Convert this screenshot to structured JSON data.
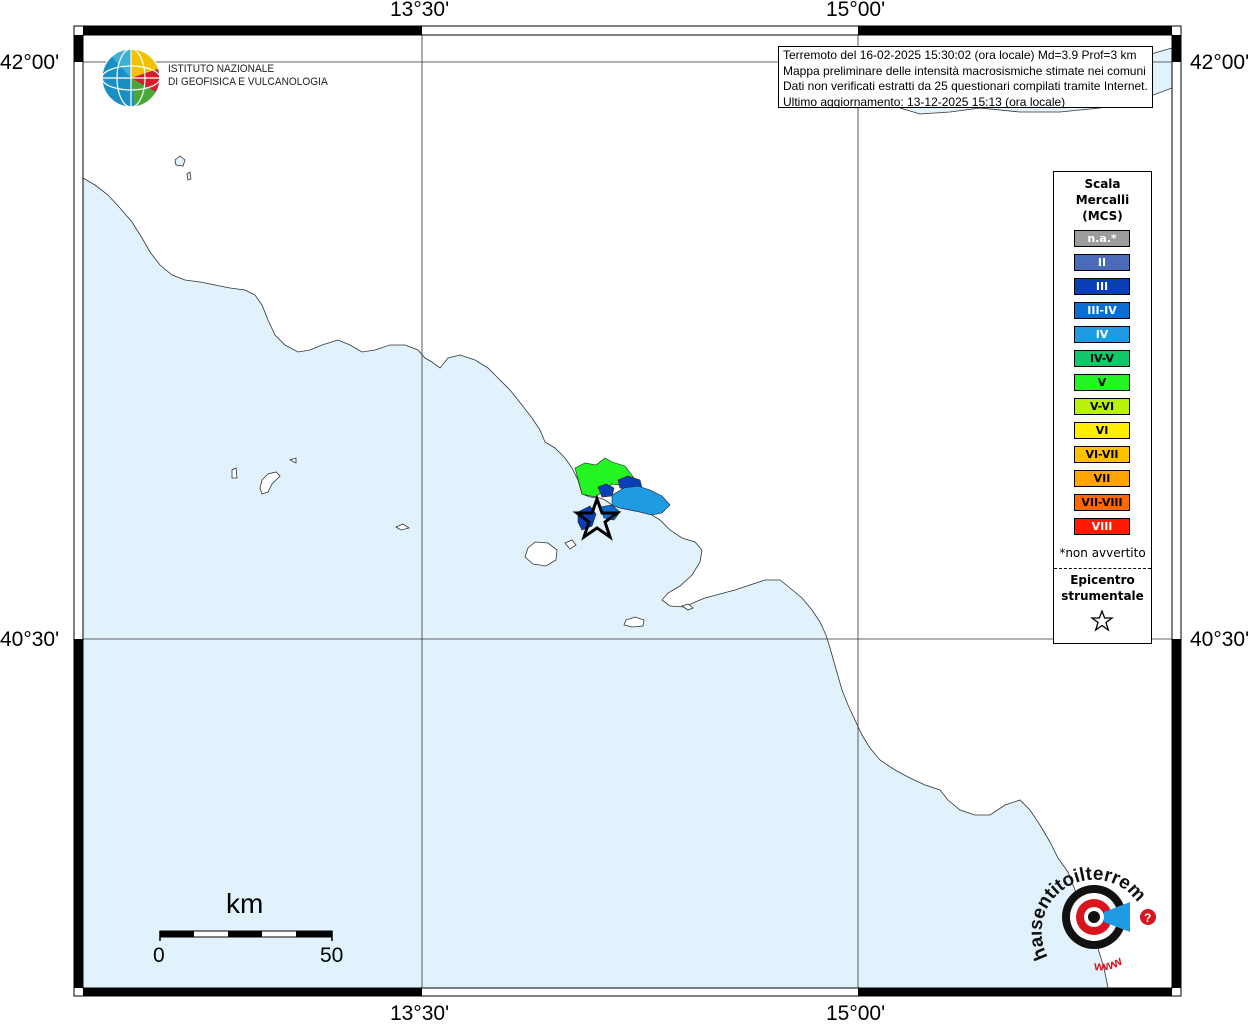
{
  "map": {
    "lon_labels": [
      "13°30'",
      "15°00'"
    ],
    "lat_labels": [
      "42°00'",
      "40°30'"
    ],
    "colors": {
      "sea": "#e2f2fc",
      "land": "#ffffff",
      "frame": "#000000"
    }
  },
  "info": {
    "line1": "Terremoto del 16-02-2025 15:30:02 (ora locale) Md=3.9 Prof=3 km",
    "line2": "Mappa preliminare delle intensità macrosismiche stimate nei comuni",
    "line3": "Dati non verificati estratti da 25 questionari compilati tramite Internet.",
    "line4": "Ultimo aggiornamento: 13-12-2025 15:13 (ora locale)"
  },
  "legend": {
    "title_line1": "Scala",
    "title_line2": "Mercalli",
    "title_line3": "(MCS)",
    "items": [
      {
        "label": "n.a.*",
        "color": "#9c9c9c",
        "text_color": "#ffffff"
      },
      {
        "label": "II",
        "color": "#4a6cb8",
        "text_color": "#ffffff"
      },
      {
        "label": "III",
        "color": "#0a3fb5",
        "text_color": "#ffffff"
      },
      {
        "label": "III-IV",
        "color": "#0a6ed0",
        "text_color": "#ffffff"
      },
      {
        "label": "IV",
        "color": "#1e9be3",
        "text_color": "#ffffff"
      },
      {
        "label": "IV-V",
        "color": "#10c86a",
        "text_color": "#000000"
      },
      {
        "label": "V",
        "color": "#22f522",
        "text_color": "#000000"
      },
      {
        "label": "V-VI",
        "color": "#b8f20a",
        "text_color": "#000000"
      },
      {
        "label": "VI",
        "color": "#ffee00",
        "text_color": "#000000"
      },
      {
        "label": "VI-VII",
        "color": "#ffc000",
        "text_color": "#000000"
      },
      {
        "label": "VII",
        "color": "#ffa500",
        "text_color": "#000000"
      },
      {
        "label": "VII-VIII",
        "color": "#ff6a00",
        "text_color": "#000000"
      },
      {
        "label": "VIII",
        "color": "#ff1a00",
        "text_color": "#ffffff"
      }
    ],
    "note": "*non avvertito",
    "epicenter_line1": "Epicentro",
    "epicenter_line2": "strumentale"
  },
  "institute": {
    "line1": "ISTITUTO NAZIONALE",
    "line2": "DI GEOFISICA E VULCANOLOGIA"
  },
  "scale_bar": {
    "unit": "km",
    "min": "0",
    "max": "50"
  },
  "hsi_logo": {
    "text": "haisentitoilterremoto.it",
    "www": "www"
  }
}
